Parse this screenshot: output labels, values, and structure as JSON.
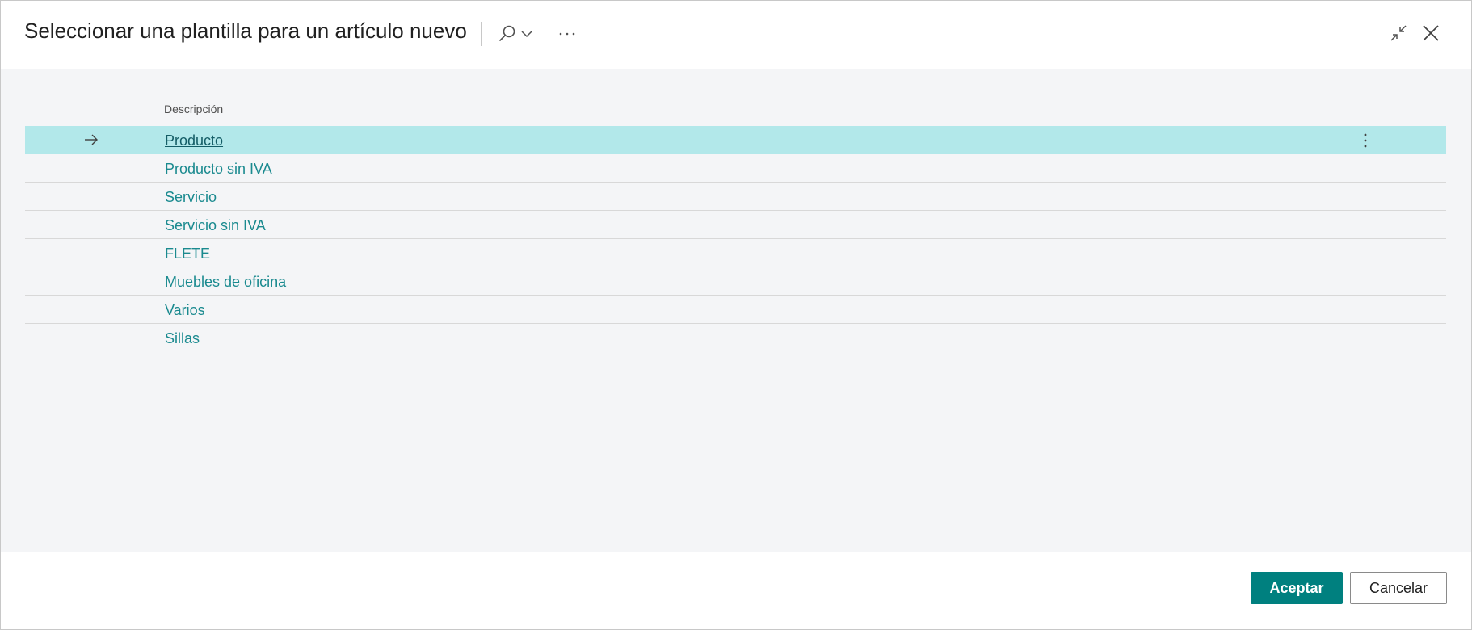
{
  "dialog": {
    "title": "Seleccionar una plantilla para un artículo nuevo",
    "icons": {
      "search": "search-icon",
      "search_dropdown": "chevron-down-icon",
      "more": "more-options-icon",
      "collapse": "collapse-icon",
      "close": "close-icon"
    }
  },
  "table": {
    "column_header": "Descripción",
    "selected_index": 0,
    "rows": [
      {
        "label": "Producto"
      },
      {
        "label": "Producto sin IVA"
      },
      {
        "label": "Servicio"
      },
      {
        "label": "Servicio sin IVA"
      },
      {
        "label": "FLETE"
      },
      {
        "label": "Muebles de oficina"
      },
      {
        "label": "Varios"
      },
      {
        "label": "Sillas"
      }
    ]
  },
  "footer": {
    "ok_label": "Aceptar",
    "cancel_label": "Cancelar"
  },
  "colors": {
    "accent": "#00807f",
    "selected_row": "#b2e8ea",
    "link": "#1a8a8f",
    "content_background": "#f4f5f7"
  }
}
